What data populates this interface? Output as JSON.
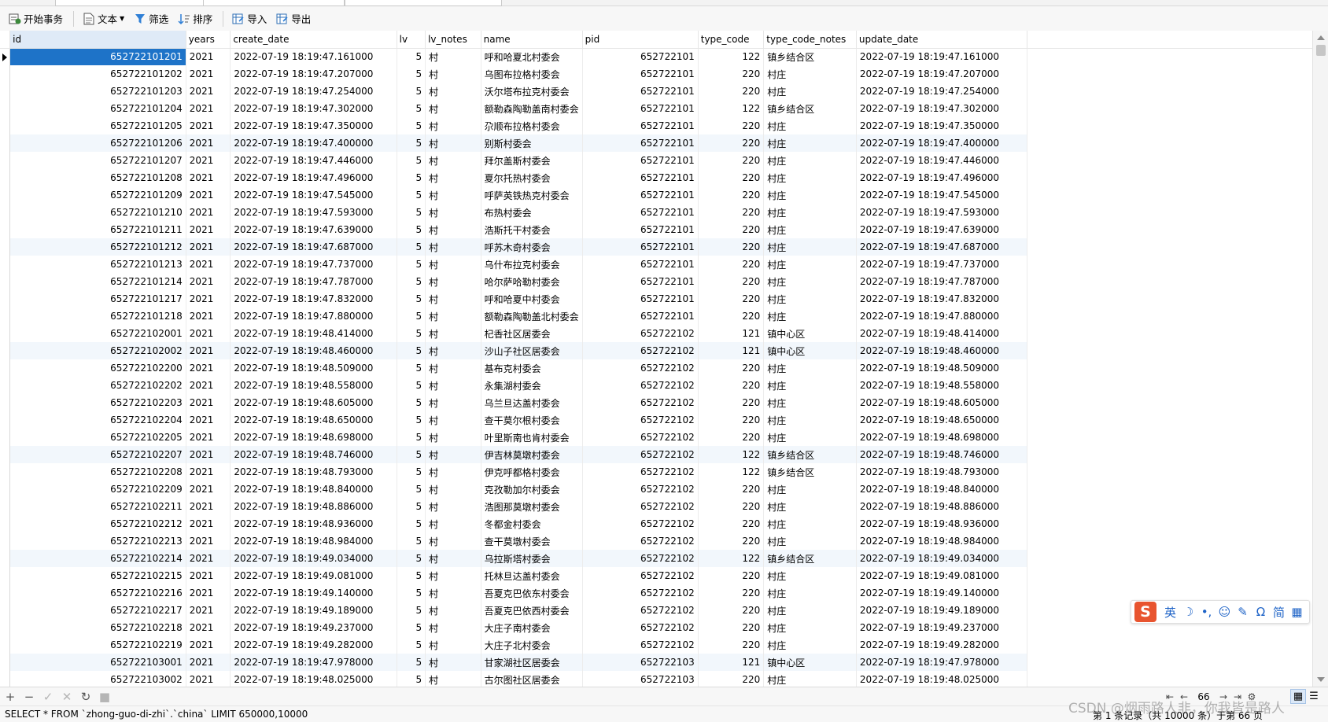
{
  "toolbar": {
    "begin_transaction": "开始事务",
    "text": "文本",
    "filter": "筛选",
    "sort": "排序",
    "import": "导入",
    "export": "导出"
  },
  "columns": [
    "id",
    "years",
    "create_date",
    "lv",
    "lv_notes",
    "name",
    "pid",
    "type_code",
    "type_code_notes",
    "update_date"
  ],
  "rows": [
    [
      "652722101201",
      "2021",
      "2022-07-19 18:19:47.161000",
      "5",
      "村",
      "呼和哈夏北村委会",
      "652722101",
      "122",
      "镇乡结合区",
      "2022-07-19 18:19:47.161000"
    ],
    [
      "652722101202",
      "2021",
      "2022-07-19 18:19:47.207000",
      "5",
      "村",
      "乌图布拉格村委会",
      "652722101",
      "220",
      "村庄",
      "2022-07-19 18:19:47.207000"
    ],
    [
      "652722101203",
      "2021",
      "2022-07-19 18:19:47.254000",
      "5",
      "村",
      "沃尔塔布拉克村委会",
      "652722101",
      "220",
      "村庄",
      "2022-07-19 18:19:47.254000"
    ],
    [
      "652722101204",
      "2021",
      "2022-07-19 18:19:47.302000",
      "5",
      "村",
      "额勒森陶勒盖南村委会",
      "652722101",
      "122",
      "镇乡结合区",
      "2022-07-19 18:19:47.302000"
    ],
    [
      "652722101205",
      "2021",
      "2022-07-19 18:19:47.350000",
      "5",
      "村",
      "尕顺布拉格村委会",
      "652722101",
      "220",
      "村庄",
      "2022-07-19 18:19:47.350000"
    ],
    [
      "652722101206",
      "2021",
      "2022-07-19 18:19:47.400000",
      "5",
      "村",
      "别斯村委会",
      "652722101",
      "220",
      "村庄",
      "2022-07-19 18:19:47.400000"
    ],
    [
      "652722101207",
      "2021",
      "2022-07-19 18:19:47.446000",
      "5",
      "村",
      "拜尔盖斯村委会",
      "652722101",
      "220",
      "村庄",
      "2022-07-19 18:19:47.446000"
    ],
    [
      "652722101208",
      "2021",
      "2022-07-19 18:19:47.496000",
      "5",
      "村",
      "夏尔托热村委会",
      "652722101",
      "220",
      "村庄",
      "2022-07-19 18:19:47.496000"
    ],
    [
      "652722101209",
      "2021",
      "2022-07-19 18:19:47.545000",
      "5",
      "村",
      "呼萨英铁热克村委会",
      "652722101",
      "220",
      "村庄",
      "2022-07-19 18:19:47.545000"
    ],
    [
      "652722101210",
      "2021",
      "2022-07-19 18:19:47.593000",
      "5",
      "村",
      "布热村委会",
      "652722101",
      "220",
      "村庄",
      "2022-07-19 18:19:47.593000"
    ],
    [
      "652722101211",
      "2021",
      "2022-07-19 18:19:47.639000",
      "5",
      "村",
      "浩斯托干村委会",
      "652722101",
      "220",
      "村庄",
      "2022-07-19 18:19:47.639000"
    ],
    [
      "652722101212",
      "2021",
      "2022-07-19 18:19:47.687000",
      "5",
      "村",
      "呼苏木奇村委会",
      "652722101",
      "220",
      "村庄",
      "2022-07-19 18:19:47.687000"
    ],
    [
      "652722101213",
      "2021",
      "2022-07-19 18:19:47.737000",
      "5",
      "村",
      "乌什布拉克村委会",
      "652722101",
      "220",
      "村庄",
      "2022-07-19 18:19:47.737000"
    ],
    [
      "652722101214",
      "2021",
      "2022-07-19 18:19:47.787000",
      "5",
      "村",
      "哈尔萨哈勒村委会",
      "652722101",
      "220",
      "村庄",
      "2022-07-19 18:19:47.787000"
    ],
    [
      "652722101217",
      "2021",
      "2022-07-19 18:19:47.832000",
      "5",
      "村",
      "呼和哈夏中村委会",
      "652722101",
      "220",
      "村庄",
      "2022-07-19 18:19:47.832000"
    ],
    [
      "652722101218",
      "2021",
      "2022-07-19 18:19:47.880000",
      "5",
      "村",
      "额勒森陶勒盖北村委会",
      "652722101",
      "220",
      "村庄",
      "2022-07-19 18:19:47.880000"
    ],
    [
      "652722102001",
      "2021",
      "2022-07-19 18:19:48.414000",
      "5",
      "村",
      "杞香社区居委会",
      "652722102",
      "121",
      "镇中心区",
      "2022-07-19 18:19:48.414000"
    ],
    [
      "652722102002",
      "2021",
      "2022-07-19 18:19:48.460000",
      "5",
      "村",
      "沙山子社区居委会",
      "652722102",
      "121",
      "镇中心区",
      "2022-07-19 18:19:48.460000"
    ],
    [
      "652722102200",
      "2021",
      "2022-07-19 18:19:48.509000",
      "5",
      "村",
      "基布克村委会",
      "652722102",
      "220",
      "村庄",
      "2022-07-19 18:19:48.509000"
    ],
    [
      "652722102202",
      "2021",
      "2022-07-19 18:19:48.558000",
      "5",
      "村",
      "永集湖村委会",
      "652722102",
      "220",
      "村庄",
      "2022-07-19 18:19:48.558000"
    ],
    [
      "652722102203",
      "2021",
      "2022-07-19 18:19:48.605000",
      "5",
      "村",
      "乌兰旦达盖村委会",
      "652722102",
      "220",
      "村庄",
      "2022-07-19 18:19:48.605000"
    ],
    [
      "652722102204",
      "2021",
      "2022-07-19 18:19:48.650000",
      "5",
      "村",
      "查干莫尔根村委会",
      "652722102",
      "220",
      "村庄",
      "2022-07-19 18:19:48.650000"
    ],
    [
      "652722102205",
      "2021",
      "2022-07-19 18:19:48.698000",
      "5",
      "村",
      "叶里斯南也肯村委会",
      "652722102",
      "220",
      "村庄",
      "2022-07-19 18:19:48.698000"
    ],
    [
      "652722102207",
      "2021",
      "2022-07-19 18:19:48.746000",
      "5",
      "村",
      "伊吉林莫墩村委会",
      "652722102",
      "122",
      "镇乡结合区",
      "2022-07-19 18:19:48.746000"
    ],
    [
      "652722102208",
      "2021",
      "2022-07-19 18:19:48.793000",
      "5",
      "村",
      "伊克呼都格村委会",
      "652722102",
      "122",
      "镇乡结合区",
      "2022-07-19 18:19:48.793000"
    ],
    [
      "652722102209",
      "2021",
      "2022-07-19 18:19:48.840000",
      "5",
      "村",
      "克孜勒加尔村委会",
      "652722102",
      "220",
      "村庄",
      "2022-07-19 18:19:48.840000"
    ],
    [
      "652722102211",
      "2021",
      "2022-07-19 18:19:48.886000",
      "5",
      "村",
      "浩图那莫墩村委会",
      "652722102",
      "220",
      "村庄",
      "2022-07-19 18:19:48.886000"
    ],
    [
      "652722102212",
      "2021",
      "2022-07-19 18:19:48.936000",
      "5",
      "村",
      "冬都金村委会",
      "652722102",
      "220",
      "村庄",
      "2022-07-19 18:19:48.936000"
    ],
    [
      "652722102213",
      "2021",
      "2022-07-19 18:19:48.984000",
      "5",
      "村",
      "查干莫墩村委会",
      "652722102",
      "220",
      "村庄",
      "2022-07-19 18:19:48.984000"
    ],
    [
      "652722102214",
      "2021",
      "2022-07-19 18:19:49.034000",
      "5",
      "村",
      "乌拉斯塔村委会",
      "652722102",
      "122",
      "镇乡结合区",
      "2022-07-19 18:19:49.034000"
    ],
    [
      "652722102215",
      "2021",
      "2022-07-19 18:19:49.081000",
      "5",
      "村",
      "托林旦达盖村委会",
      "652722102",
      "220",
      "村庄",
      "2022-07-19 18:19:49.081000"
    ],
    [
      "652722102216",
      "2021",
      "2022-07-19 18:19:49.140000",
      "5",
      "村",
      "吾夏克巴依东村委会",
      "652722102",
      "220",
      "村庄",
      "2022-07-19 18:19:49.140000"
    ],
    [
      "652722102217",
      "2021",
      "2022-07-19 18:19:49.189000",
      "5",
      "村",
      "吾夏克巴依西村委会",
      "652722102",
      "220",
      "村庄",
      "2022-07-19 18:19:49.189000"
    ],
    [
      "652722102218",
      "2021",
      "2022-07-19 18:19:49.237000",
      "5",
      "村",
      "大庄子南村委会",
      "652722102",
      "220",
      "村庄",
      "2022-07-19 18:19:49.237000"
    ],
    [
      "652722102219",
      "2021",
      "2022-07-19 18:19:49.282000",
      "5",
      "村",
      "大庄子北村委会",
      "652722102",
      "220",
      "村庄",
      "2022-07-19 18:19:49.282000"
    ],
    [
      "652722103001",
      "2021",
      "2022-07-19 18:19:47.978000",
      "5",
      "村",
      "甘家湖社区居委会",
      "652722103",
      "121",
      "镇中心区",
      "2022-07-19 18:19:47.978000"
    ],
    [
      "652722103002",
      "2021",
      "2022-07-19 18:19:48.025000",
      "5",
      "村",
      "古尔图社区居委会",
      "652722103",
      "220",
      "村庄",
      "2022-07-19 18:19:48.025000"
    ]
  ],
  "selected_row_index": 0,
  "pager": {
    "current_page": "66"
  },
  "status": {
    "sql": "SELECT * FROM `zhong-guo-di-zhi`.`china` LIMIT 650000,10000",
    "records": "第 1 条记录（共 10000 条）于第 66 页"
  },
  "watermark": "CSDN @烟雨路人非，你我皆是路人",
  "ime": {
    "logo": "S",
    "items": [
      "英",
      "☽",
      "•,",
      "☺",
      "✎",
      "Ω",
      "简",
      "▦"
    ]
  },
  "colors": {
    "selection": "#1e73c8",
    "alt_row": "#f2f7fc",
    "ime_logo": "#e8542f",
    "icon_blue": "#1e63c7"
  }
}
